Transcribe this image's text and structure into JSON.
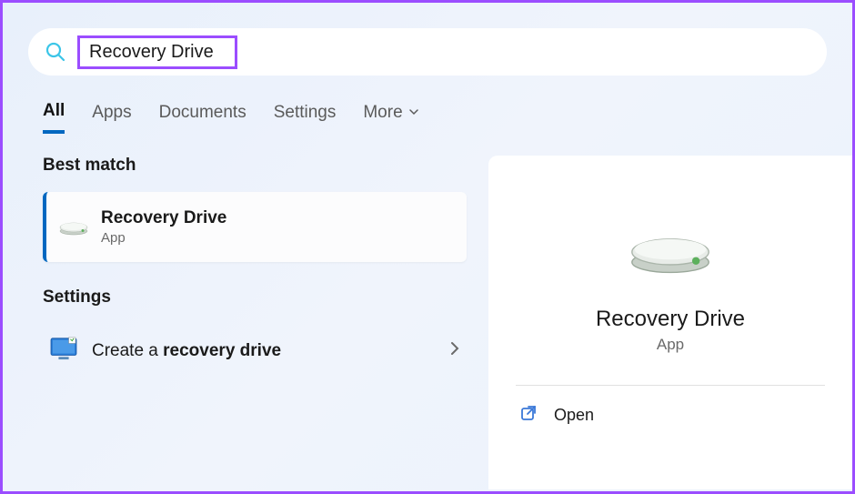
{
  "search": {
    "query": "Recovery Drive"
  },
  "tabs": {
    "all": "All",
    "apps": "Apps",
    "documents": "Documents",
    "settings": "Settings",
    "more": "More"
  },
  "sections": {
    "bestMatch": "Best match",
    "settings": "Settings"
  },
  "bestMatch": {
    "title": "Recovery Drive",
    "subtitle": "App"
  },
  "settingsResult": {
    "prefix": "Create a ",
    "bold": "recovery drive"
  },
  "details": {
    "title": "Recovery Drive",
    "subtitle": "App"
  },
  "actions": {
    "open": "Open"
  }
}
